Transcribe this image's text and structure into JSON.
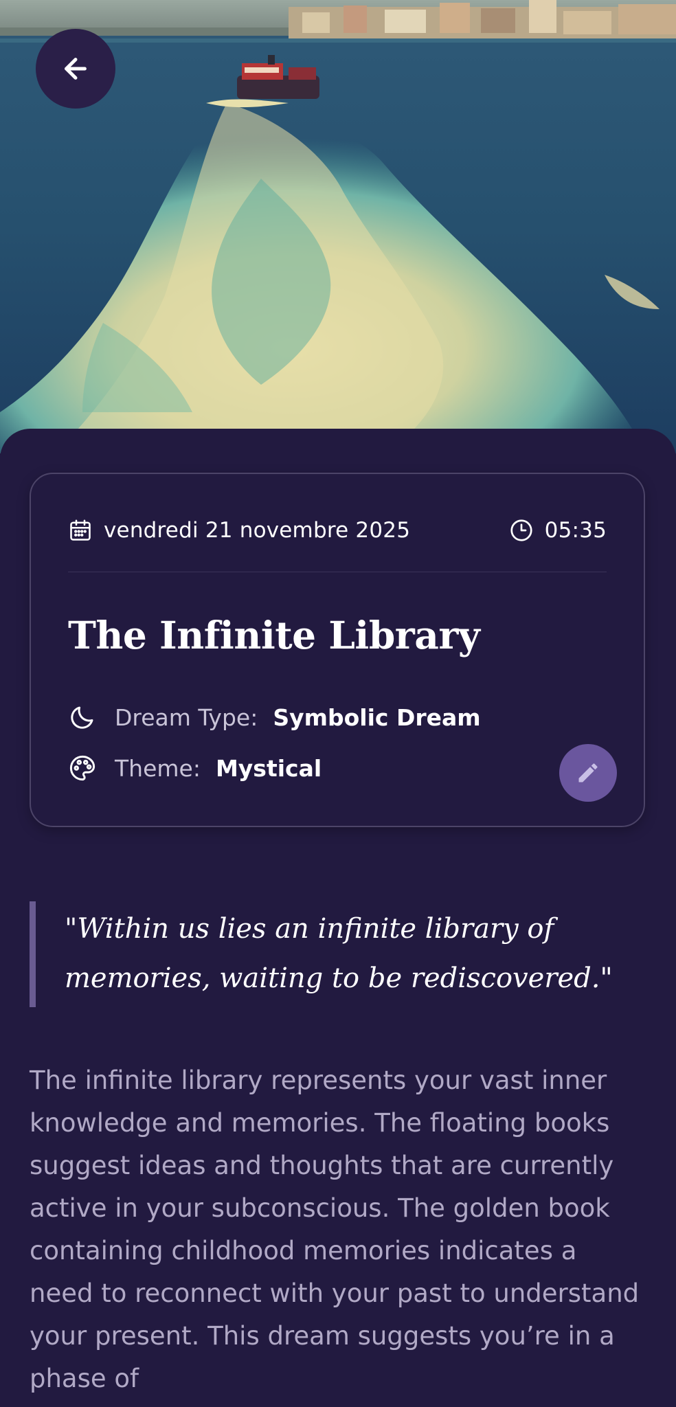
{
  "header": {
    "back_icon": "arrow-left-icon",
    "hero_image": "boat-wake-sea-photo"
  },
  "card": {
    "date": "vendredi 21 novembre 2025",
    "time": "05:35",
    "title": "The Infinite Library",
    "dream_type_label": "Dream Type:",
    "dream_type_value": "Symbolic Dream",
    "theme_label": "Theme:",
    "theme_value": "Mystical",
    "date_icon": "calendar-icon",
    "time_icon": "clock-icon",
    "dream_type_icon": "moon-icon",
    "theme_icon": "palette-icon",
    "edit_icon": "pencil-icon"
  },
  "quote": "\"Within us lies an infinite library of memories, waiting to be rediscovered.\"",
  "interpretation": "The infinite library represents your vast inner knowledge and memories. The floating books suggest ideas and thoughts that are currently active in your subconscious. The golden book containing childhood memories indicates a need to reconnect with your past to understand your present. This dream suggests you’re in a phase of",
  "colors": {
    "background": "#221a40",
    "card_border": "#4c4468",
    "accent": "#6a569e",
    "quote_bar": "#6a5c92",
    "body_text": "#b1a9c6"
  }
}
